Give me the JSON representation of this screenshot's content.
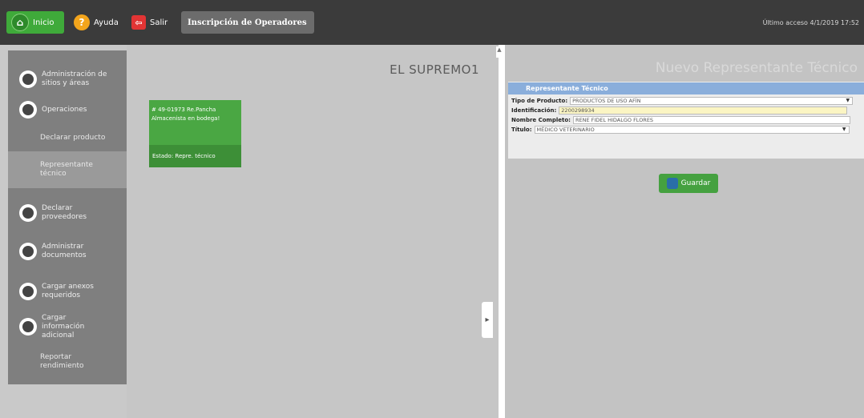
{
  "topbar": {
    "home_label": "Inicio",
    "help_label": "Ayuda",
    "exit_label": "Salir",
    "title": "Inscripción de Operadores",
    "last_access": "Último acceso 4/1/2019 17:52"
  },
  "sidebar": {
    "items": [
      {
        "label": "Administración de sitios y áreas",
        "icon": "gear-icon"
      },
      {
        "label": "Operaciones",
        "icon": "operations-icon"
      },
      {
        "label": "Declarar producto",
        "icon": ""
      },
      {
        "label": "Representante técnico",
        "icon": ""
      },
      {
        "label": "Declarar proveedores",
        "icon": "providers-icon"
      },
      {
        "label": "Administrar documentos",
        "icon": "documents-icon"
      },
      {
        "label": "Cargar anexos requeridos",
        "icon": "attachment-icon"
      },
      {
        "label": "Cargar información adicional",
        "icon": "info-icon"
      },
      {
        "label": "Reportar rendimiento",
        "icon": ""
      }
    ]
  },
  "center": {
    "title": "EL SUPREMO1",
    "card": {
      "line1": "# 49-01973 Re.Pancha",
      "line2": "Almacenista en bodega!",
      "state": "Estado: Repre. técnico"
    }
  },
  "right": {
    "title": "Nuevo Representante Técnico",
    "form": {
      "header": "Representante Técnico",
      "fields": [
        {
          "label": "Tipo de Producto:",
          "value": "PRODUCTOS DE USO AFÍN"
        },
        {
          "label": "Identificación:",
          "value": "2200298934"
        },
        {
          "label": "Nombre Completo:",
          "value": "RENE FIDEL HIDALGO FLORES"
        },
        {
          "label": "Título:",
          "value": "MÉDICO VETERINARIO"
        }
      ]
    },
    "save_label": "Guardar"
  },
  "colors": {
    "accent_green": "#45a140",
    "form_header_blue": "#8aaedb",
    "highlight_yellow": "#fbf5c3"
  }
}
